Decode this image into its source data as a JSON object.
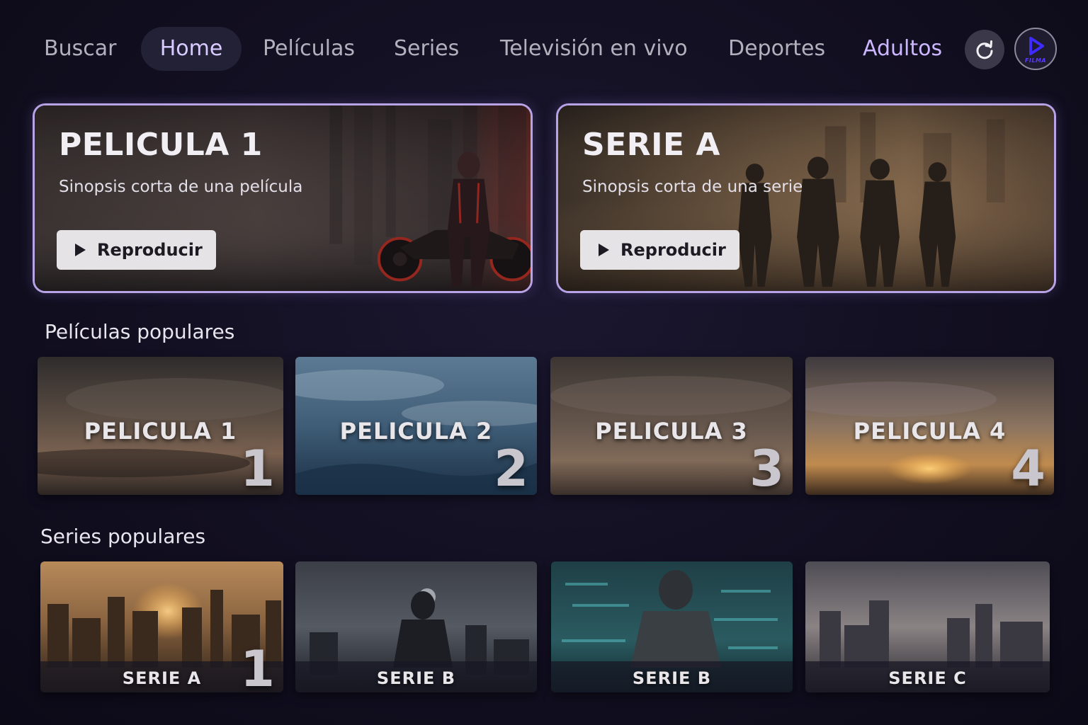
{
  "nav": {
    "items": [
      {
        "label": "Buscar"
      },
      {
        "label": "Home"
      },
      {
        "label": "Películas"
      },
      {
        "label": "Series"
      },
      {
        "label": "Televisión en vivo"
      },
      {
        "label": "Deportes"
      },
      {
        "label": "Adultos"
      }
    ],
    "active": "Home",
    "refresh_icon": "refresh-icon",
    "profile_icon": "play-logo-icon",
    "profile_caption": "FILMA"
  },
  "hero": [
    {
      "title": "PELICULA 1",
      "synopsis": "Sinopsis corta de una película",
      "button_label": "Reproducir",
      "button_icon": "play-icon"
    },
    {
      "title": "SERIE A",
      "synopsis": "Sinopsis corta de una serie",
      "button_label": "Reproducir",
      "button_icon": "play-icon"
    }
  ],
  "popular_movies": {
    "title": "Películas populares",
    "items": [
      {
        "title": "PELICULA 1",
        "rank": "1"
      },
      {
        "title": "PELICULA 2",
        "rank": "2"
      },
      {
        "title": "PELICULA 3",
        "rank": "3"
      },
      {
        "title": "PELICULA 4",
        "rank": "4"
      }
    ]
  },
  "popular_series": {
    "title": "Series populares",
    "items": [
      {
        "title": "SERIE A",
        "rank": "1"
      },
      {
        "title": "SERIE B",
        "rank": ""
      },
      {
        "title": "SERIE B",
        "rank": ""
      },
      {
        "title": "SERIE C",
        "rank": ""
      }
    ]
  },
  "colors": {
    "background": "#120f21",
    "accent": "#cbb6ff",
    "active_nav_bg": "#232136",
    "hero_border": "#b7a3e6",
    "button_bg": "#e6e3e6",
    "logo_blue": "#3d2bff"
  }
}
